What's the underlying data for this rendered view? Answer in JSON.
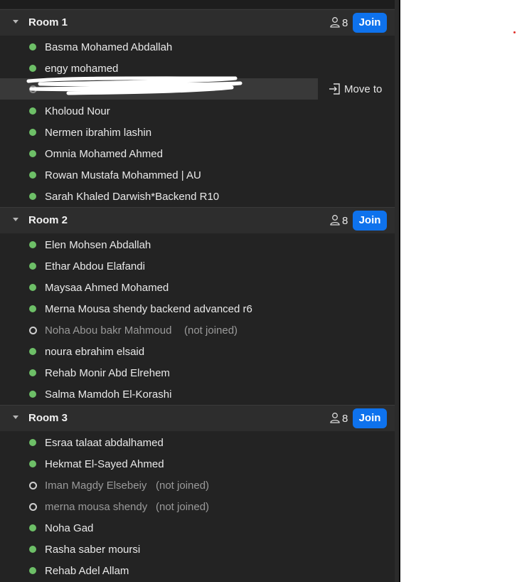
{
  "rooms": [
    {
      "name": "Room 1",
      "count": "8",
      "join_label": "Join",
      "participants": [
        {
          "name": "Basma Mohamed Abdallah",
          "status": "joined",
          "note": ""
        },
        {
          "name": "engy mohamed",
          "status": "joined",
          "note": ""
        },
        {
          "name": "",
          "status": "redacted",
          "note": ""
        },
        {
          "name": "Kholoud Nour",
          "status": "joined",
          "note": ""
        },
        {
          "name": "Nermen ibrahim lashin",
          "status": "joined",
          "note": ""
        },
        {
          "name": "Omnia Mohamed Ahmed",
          "status": "joined",
          "note": ""
        },
        {
          "name": "Rowan Mustafa Mohammed | AU",
          "status": "joined",
          "note": ""
        },
        {
          "name": "Sarah Khaled Darwish*Backend R10",
          "status": "joined",
          "note": ""
        }
      ]
    },
    {
      "name": "Room 2",
      "count": "8",
      "join_label": "Join",
      "participants": [
        {
          "name": "Elen Mohsen Abdallah",
          "status": "joined",
          "note": ""
        },
        {
          "name": "Ethar Abdou Elafandi",
          "status": "joined",
          "note": ""
        },
        {
          "name": "Maysaa Ahmed Mohamed",
          "status": "joined",
          "note": ""
        },
        {
          "name": "Merna Mousa shendy backend advanced r6",
          "status": "joined",
          "note": ""
        },
        {
          "name": "Noha Abou bakr Mahmoud",
          "status": "not_joined",
          "note": "(not joined)"
        },
        {
          "name": "noura ebrahim elsaid",
          "status": "joined",
          "note": ""
        },
        {
          "name": "Rehab Monir Abd Elrehem",
          "status": "joined",
          "note": ""
        },
        {
          "name": "Salma Mamdoh El-Korashi",
          "status": "joined",
          "note": ""
        }
      ]
    },
    {
      "name": "Room 3",
      "count": "8",
      "join_label": "Join",
      "participants": [
        {
          "name": "Esraa talaat abdalhamed",
          "status": "joined",
          "note": ""
        },
        {
          "name": "Hekmat El-Sayed Ahmed",
          "status": "joined",
          "note": ""
        },
        {
          "name": "Iman Magdy Elsebeiy",
          "status": "not_joined",
          "note": "(not joined)"
        },
        {
          "name": "merna mousa shendy",
          "status": "not_joined",
          "note": "(not joined)"
        },
        {
          "name": "Noha Gad",
          "status": "joined",
          "note": ""
        },
        {
          "name": "Rasha saber moursi",
          "status": "joined",
          "note": ""
        },
        {
          "name": "Rehab Adel Allam",
          "status": "joined",
          "note": ""
        }
      ]
    }
  ],
  "move_to_label": "Move to",
  "icons": {
    "caret": "caret-down-icon",
    "participants": "person-icon",
    "move": "move-to-icon"
  },
  "colors": {
    "join_button": "#0e72ed",
    "joined_dot": "#6dbf67",
    "panel_bg": "#232323"
  }
}
